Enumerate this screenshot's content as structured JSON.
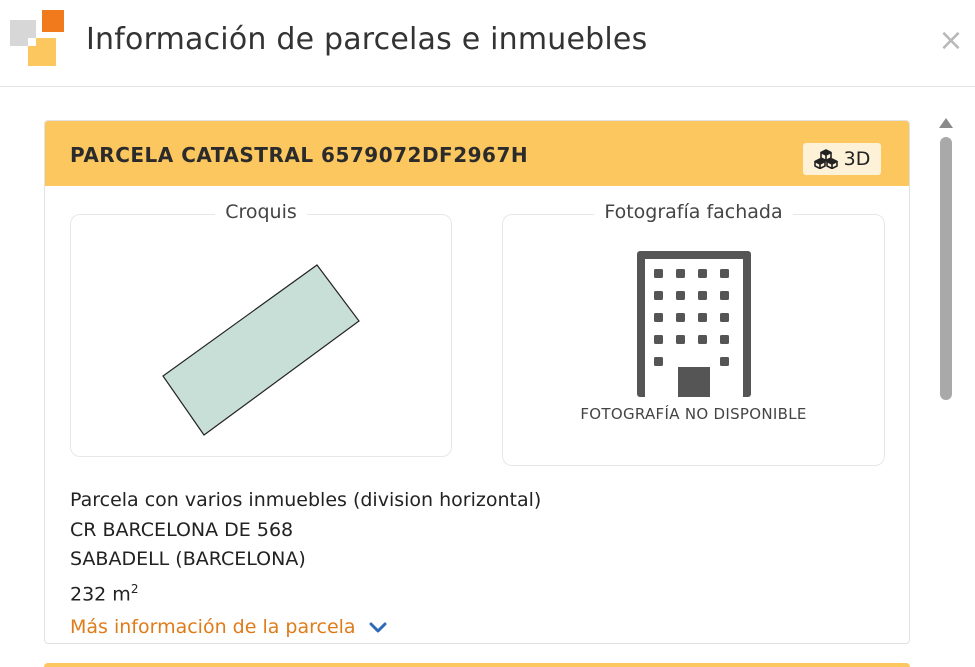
{
  "header": {
    "title": "Información de parcelas e inmuebles",
    "logo_icon": "cadastre-logo-icon",
    "close_label": "×"
  },
  "parcel": {
    "title": "PARCELA CATASTRAL 6579072DF2967H",
    "view_3d_label": "3D",
    "view_3d_icon": "cubes-icon",
    "croquis_label": "Croquis",
    "photo_label": "Fotografía fachada",
    "photo_unavailable": "FOTOGRAFÍA NO DISPONIBLE",
    "photo_icon": "building-icon",
    "description": "Parcela con varios inmuebles (division horizontal)",
    "address": "CR BARCELONA DE 568",
    "city": "SABADELL (BARCELONA)",
    "area_value": "232 m",
    "area_unit_exp": "2",
    "more_info_label": "Más información de la parcela",
    "more_info_icon": "chevron-down-icon"
  },
  "colors": {
    "header_band": "#fcc75f",
    "link": "#e07b1a",
    "parcel_fill": "#c8dfd8",
    "icon_dark": "#555555"
  }
}
